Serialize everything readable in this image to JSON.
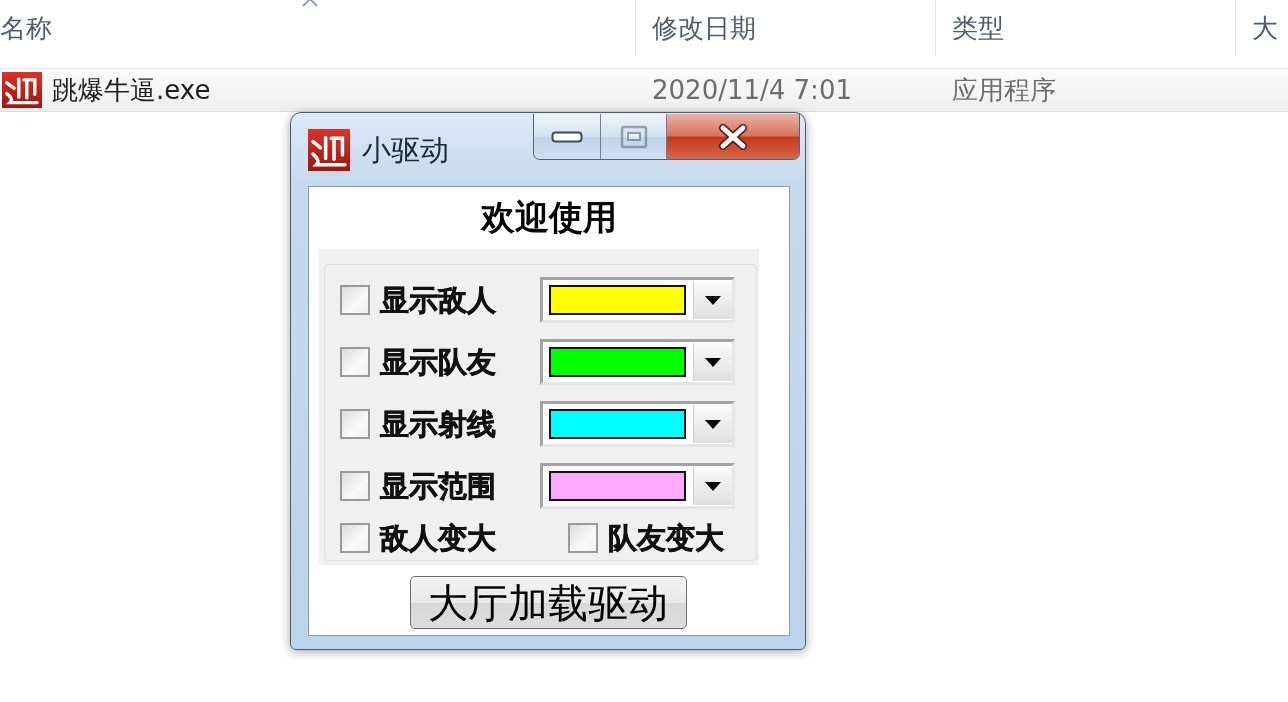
{
  "file_list": {
    "columns": [
      {
        "label": "名称",
        "sorted": true
      },
      {
        "label": "修改日期",
        "sorted": false
      },
      {
        "label": "类型",
        "sorted": false
      },
      {
        "label": "大",
        "sorted": false
      }
    ],
    "rows": [
      {
        "name": "跳爆牛逼.exe",
        "modified": "2020/11/4 7:01",
        "type": "应用程序",
        "selected": true
      }
    ]
  },
  "dialog": {
    "title": "小驱动",
    "window_buttons": [
      {
        "kind": "minimize",
        "disabled": false
      },
      {
        "kind": "maximize",
        "disabled": true
      },
      {
        "kind": "close",
        "disabled": false
      }
    ],
    "heading": "欢迎使用",
    "color_options": [
      {
        "label": "显示敌人",
        "checked": false,
        "color": "#ffff00"
      },
      {
        "label": "显示队友",
        "checked": false,
        "color": "#00ff00"
      },
      {
        "label": "显示射线",
        "checked": false,
        "color": "#00ffff"
      },
      {
        "label": "显示范围",
        "checked": false,
        "color": "#ffa8ff"
      }
    ],
    "toggles": [
      {
        "label": "敌人变大",
        "checked": false
      },
      {
        "label": "队友变大",
        "checked": false
      }
    ],
    "button": "大厅加载驱动"
  }
}
